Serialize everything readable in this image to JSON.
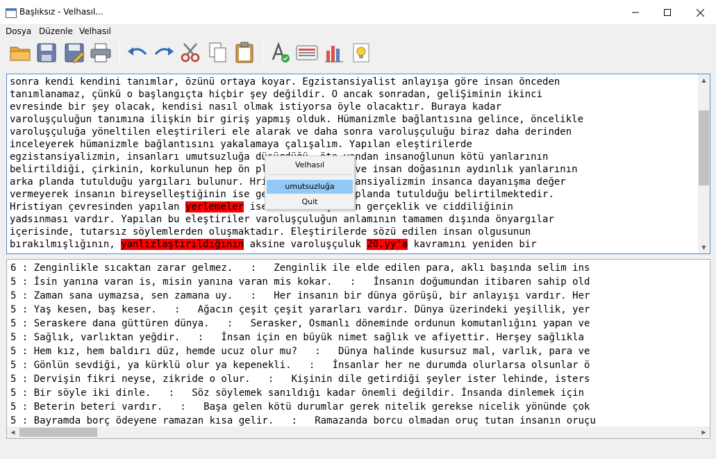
{
  "window": {
    "title": "Başlıksız - Velhasıl..."
  },
  "menu": {
    "file": "Dosya",
    "edit": "Düzenle",
    "app": "Velhasıl"
  },
  "toolbar": {
    "icons": [
      "open-folder-icon",
      "save-icon",
      "save-as-icon",
      "print-icon",
      "undo-icon",
      "redo-icon",
      "cut-icon",
      "copy-icon",
      "paste-icon",
      "spellcheck-icon",
      "keyboard-icon",
      "chart-icon",
      "idea-icon"
    ]
  },
  "editor": {
    "lines": [
      [
        {
          "t": "sonra kendi kendini tanımlar, özünü ortaya koyar. Egzistansiyalist anlayışa göre insan önceden"
        }
      ],
      [
        {
          "t": "tanımlanamaz, çünkü o başlangıçta hiçbir şey değildir. O ancak sonradan, geliŞiminin ikinci"
        }
      ],
      [
        {
          "t": "evresinde bir şey olacak, kendisi nasıl olmak istiyorsa öyle olacaktır. Buraya kadar"
        }
      ],
      [
        {
          "t": "varoluşçuluğun tanımına ilişkin bir giriş yapmış olduk. Hümanizmle bağlantısına gelince, öncelikle"
        }
      ],
      [
        {
          "t": "varoluşçuluğa yöneltilen eleştirileri ele alarak ve daha sonra varoluşçuluğu biraz daha derinden"
        }
      ],
      [
        {
          "t": "inceleyerek hümanizmle bağlantısını yakalamaya çalışalım. Yapılan eleştirilerde"
        }
      ],
      [
        {
          "t": "egzistansiyalizmin, insanları umutsuzluğa düşürdüğü, öte yandan insanoğlunun kötü yanlarının"
        }
      ],
      [
        {
          "t": "belirtildiği, çirkinin, korkulunun hep ön planda tutulduğu ve insan doğasının aydınlık yanlarının"
        }
      ],
      [
        {
          "t": "arka planda tutulduğu yargıları bulunur. Hristiyanca egzistansiyalizmin insanca dayanışma değer"
        }
      ],
      [
        {
          "t": "vermeyerek insanın bireyselleştiğinin ise gerçekliğinin ön planda tutulduğu belirtilmektedir."
        }
      ],
      [
        {
          "t": "Hristiyan çevresinden yapılan "
        },
        {
          "t": "yerlemeler",
          "hl": true
        },
        {
          "t": " ise insanın işlerin gerçeklik ve ciddiliğinin"
        }
      ],
      [
        {
          "t": "yadsınması vardır. Yapılan bu eleştiriler varoluşçuluğun anlamının tamamen dışında önyargılar"
        }
      ],
      [
        {
          "t": "içerisinde, tutarsız söylemlerden oluşmaktadır. Eleştirilerde sözü edilen insan olgusunun"
        }
      ],
      [
        {
          "t": "bırakılmışlığının, "
        },
        {
          "t": "yanlızlaştırıldığının",
          "hl": true
        },
        {
          "t": " aksine varoluşçuluk "
        },
        {
          "t": "20.yy'a",
          "hl": true
        },
        {
          "t": " kavramını yeniden bir"
        }
      ]
    ]
  },
  "context_menu": {
    "items": [
      "Velhasıl",
      "umutsuzluğa",
      "Quit"
    ],
    "selected": "umutsuzluğa"
  },
  "results": {
    "rows": [
      "6 : Zenginlikle sıcaktan zarar gelmez.   :   Zenginlik ile elde edilen para, aklı başında selim ins",
      "5 : İsin yanına varan is, misin yanına varan mis kokar.   :   İnsanın doğumundan itibaren sahip old",
      "5 : Zaman sana uymazsa, sen zamana uy.   :   Her insanın bir dünya görüşü, bir anlayışı vardır. Her",
      "5 : Yaş kesen, baş keser.   :   Ağacın çeşit çeşit yararları vardır. Dünya üzerindeki yeşillik, yer",
      "5 : Seraskere dana güttüren dünya.   :   Serasker, Osmanlı döneminde ordunun komutanlığını yapan ve",
      "5 : Sağlık, varlıktan yeğdir.   :   İnsan için en büyük nimet sağlık ve afiyettir. Herşey sağlıkla",
      "5 : Hem kız, hem baldırı düz, hemde ucuz olur mu?   :   Dünya halinde kusursuz mal, varlık, para ve",
      "5 : Gönlün sevdiği, ya kürklü olur ya kepenekli.   :   İnsanlar her ne durumda olurlarsa olsunlar ö",
      "5 : Dervişin fikri neyse, zikride o olur.   :   Kişinin dile getirdiği şeyler ister lehinde, isters",
      "5 : Bir söyle iki dinle.   :   Söz söylemek sanıldığı kadar önemli değildir. İnsanda dinlemek için",
      "5 : Beterin beteri vardır.   :   Başa gelen kötü durumlar gerek nitelik gerekse nicelik yönünde çok",
      "5 : Bayramda borç ödeyene ramazan kısa gelir.   :   Ramazanda borcu olmadan oruç tutan insanın oruçu"
    ]
  }
}
